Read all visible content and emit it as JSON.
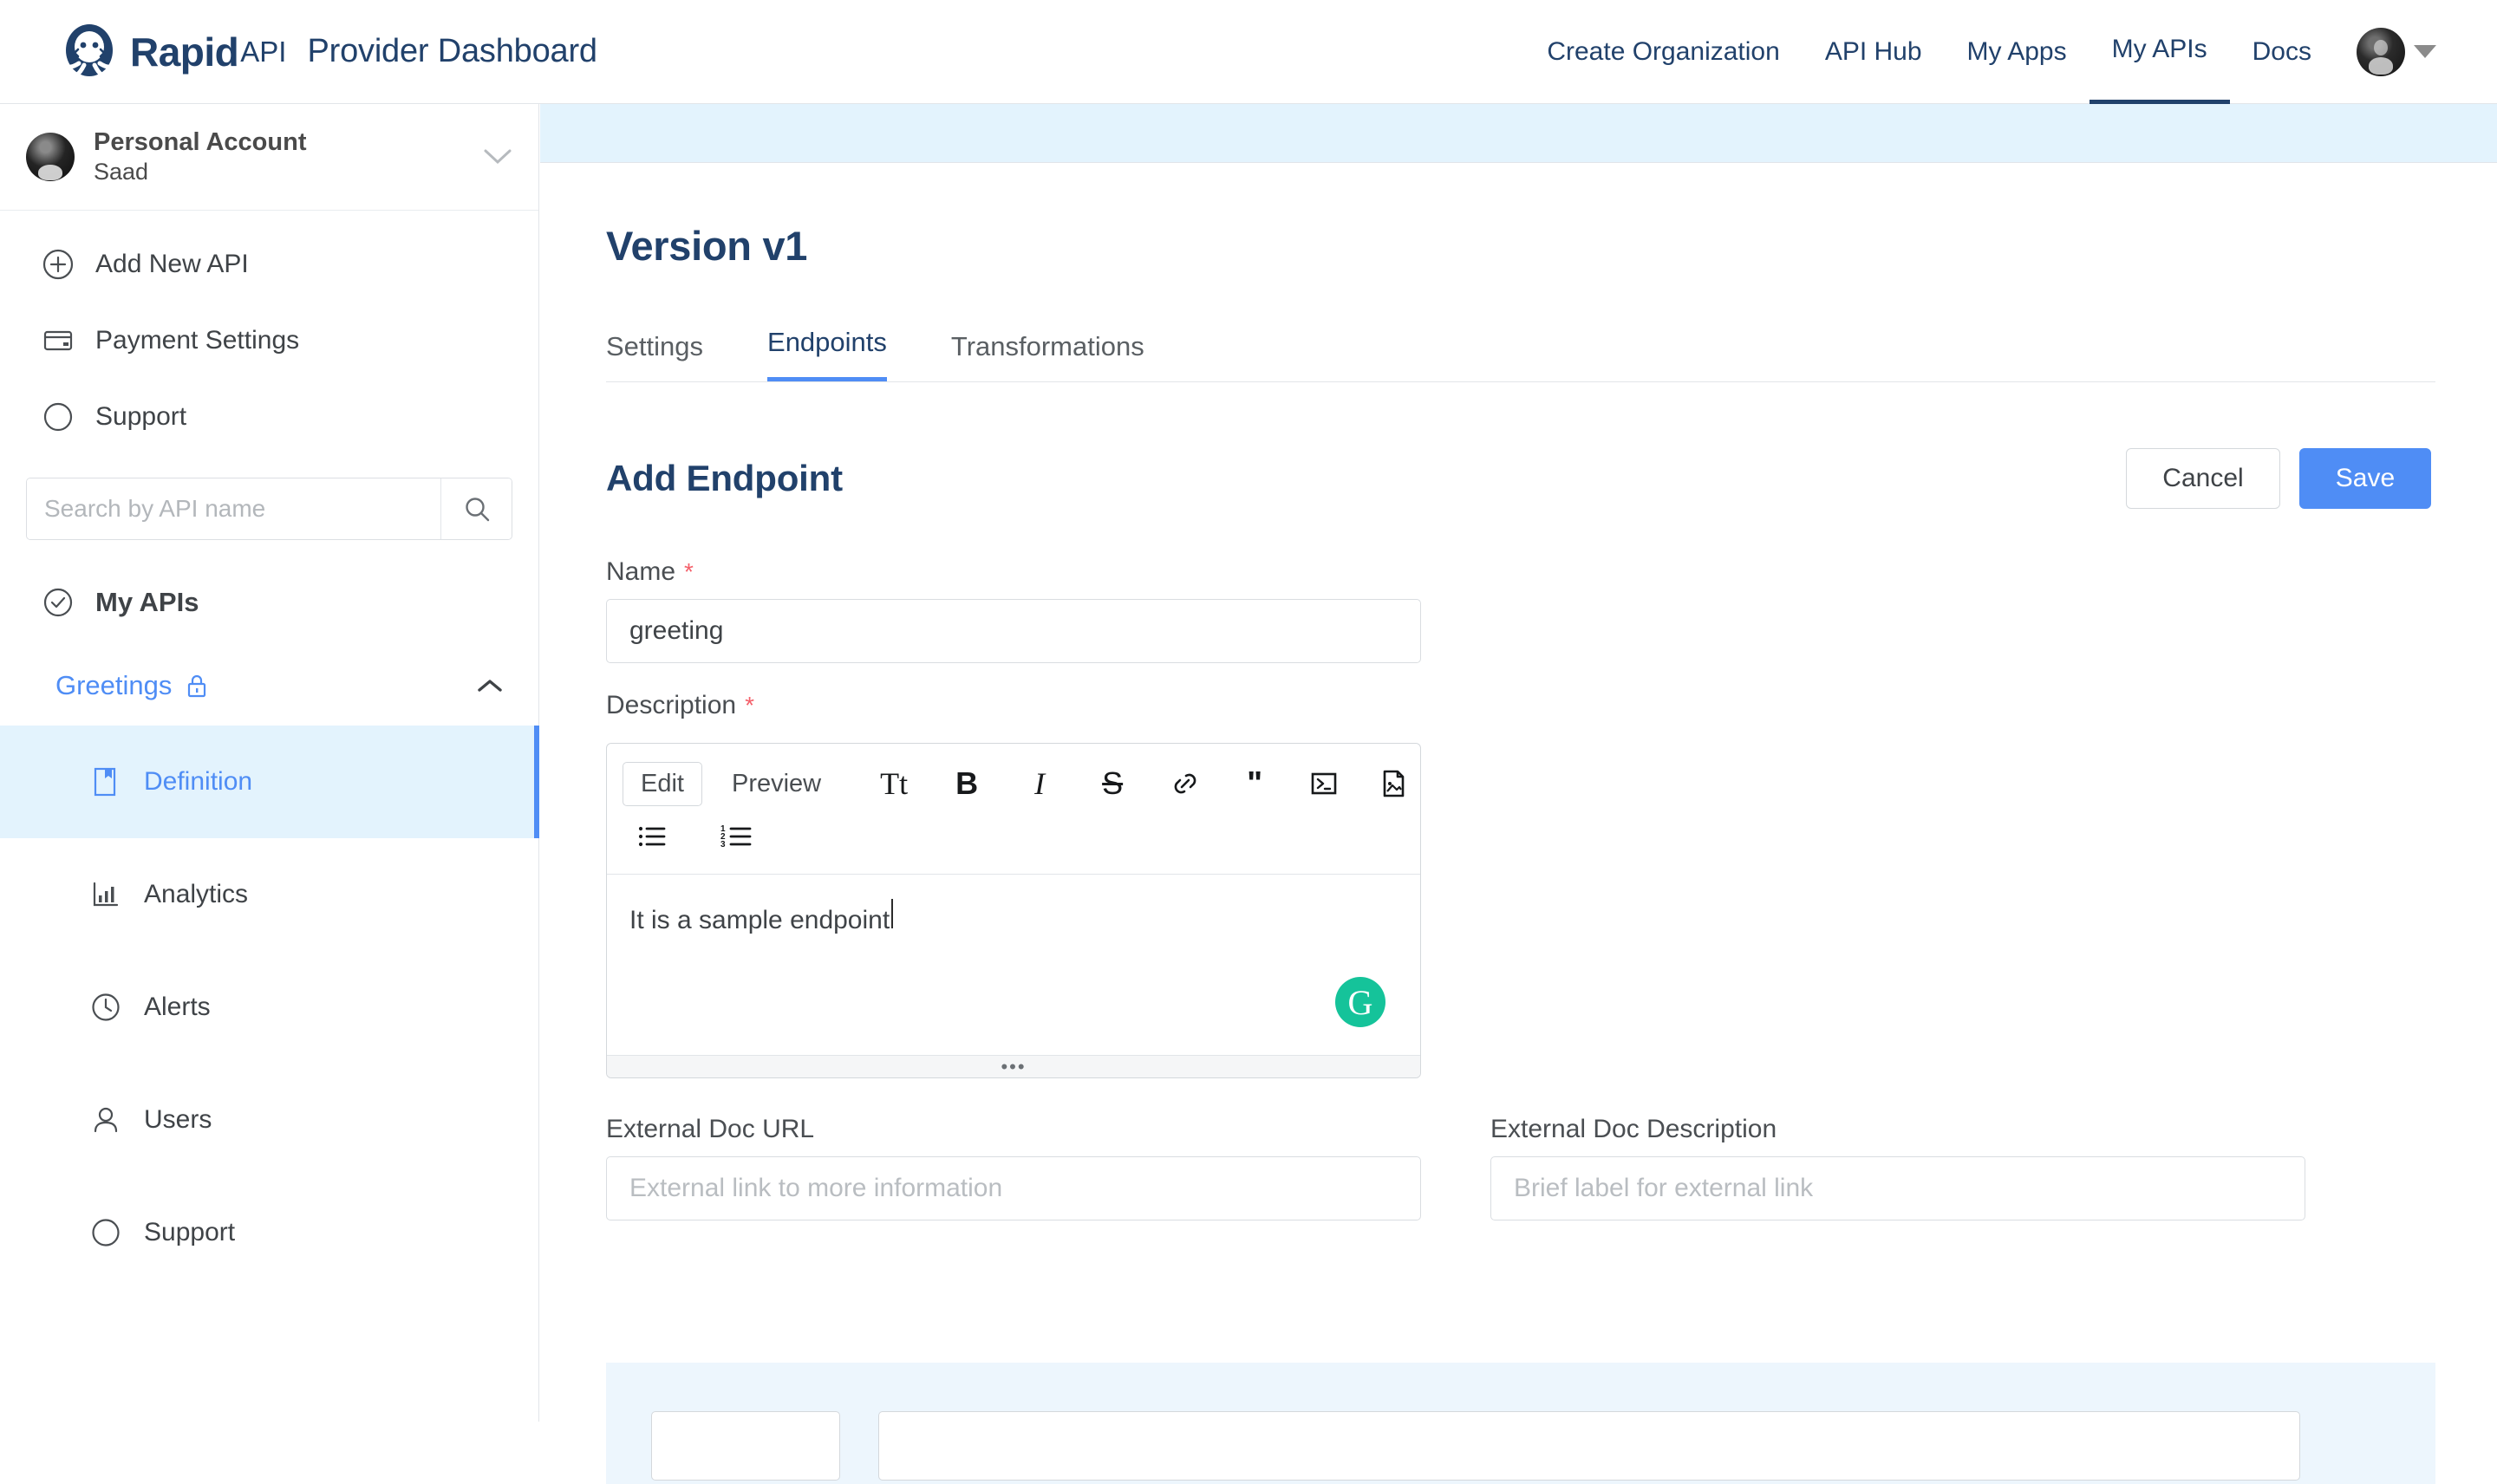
{
  "brand": {
    "name_bold": "Rapid",
    "name_light": "API",
    "subtitle": "Provider Dashboard",
    "logo_icon": "rapidapi-octopus-logo-icon",
    "primary_navy": "#21416b",
    "accent_blue": "#4f8df5",
    "required_red": "#f4606a",
    "panel_blue": "#e3f3fd"
  },
  "topnav": {
    "items": [
      {
        "label": "Create Organization",
        "active": false
      },
      {
        "label": "API Hub",
        "active": false
      },
      {
        "label": "My Apps",
        "active": false
      },
      {
        "label": "My APIs",
        "active": true
      },
      {
        "label": "Docs",
        "active": false
      }
    ],
    "avatar_icon": "user-avatar",
    "caret_icon": "caret-down-icon"
  },
  "sidebar": {
    "account": {
      "title": "Personal Account",
      "username": "Saad",
      "avatar_icon": "user-avatar",
      "chevron_icon": "chevron-down-icon"
    },
    "nav": [
      {
        "label": "Add New API",
        "icon": "plus-circle-icon"
      },
      {
        "label": "Payment Settings",
        "icon": "credit-card-icon"
      },
      {
        "label": "Support",
        "icon": "compass-icon"
      }
    ],
    "search": {
      "placeholder": "Search by API name",
      "value": "",
      "icon": "search-icon"
    },
    "my_apis": {
      "label": "My APIs",
      "icon": "check-circle-icon"
    },
    "api_group": {
      "label": "Greetings",
      "lock_icon": "lock-icon",
      "chevron_icon": "chevron-up-icon",
      "expanded": true
    },
    "sub_items": [
      {
        "label": "Definition",
        "icon": "book-icon",
        "active": true
      },
      {
        "label": "Analytics",
        "icon": "bar-chart-icon",
        "active": false
      },
      {
        "label": "Alerts",
        "icon": "clock-icon",
        "active": false
      },
      {
        "label": "Users",
        "icon": "user-icon",
        "active": false
      },
      {
        "label": "Support",
        "icon": "compass-icon",
        "active": false
      }
    ]
  },
  "main": {
    "version_title": "Version v1",
    "tabs": [
      {
        "label": "Settings",
        "active": false
      },
      {
        "label": "Endpoints",
        "active": true
      },
      {
        "label": "Transformations",
        "active": false
      }
    ],
    "section_title": "Add Endpoint",
    "cancel_label": "Cancel",
    "save_label": "Save",
    "form": {
      "name": {
        "label": "Name",
        "required_marker": "*",
        "value": "greeting",
        "placeholder": ""
      },
      "description": {
        "label": "Description",
        "required_marker": "*",
        "value": "It is a sample endpoint",
        "editor": {
          "edit_label": "Edit",
          "preview_label": "Preview",
          "tools_row1": [
            {
              "glyph": "Tt",
              "icon": "text-size-icon"
            },
            {
              "glyph": "B",
              "icon": "bold-icon"
            },
            {
              "glyph": "I",
              "icon": "italic-icon"
            },
            {
              "glyph": "S",
              "icon": "strikethrough-icon"
            },
            {
              "glyph": "",
              "icon": "link-icon"
            },
            {
              "glyph": "\"",
              "icon": "quote-icon"
            },
            {
              "glyph": "",
              "icon": "code-block-icon"
            },
            {
              "glyph": "",
              "icon": "image-icon"
            }
          ],
          "tools_row2": [
            {
              "icon": "bulleted-list-icon"
            },
            {
              "icon": "numbered-list-icon"
            }
          ],
          "grammarly_badge": "G",
          "resize_handle": "•••"
        }
      },
      "external_doc_url": {
        "label": "External Doc URL",
        "value": "",
        "placeholder": "External link to more information"
      },
      "external_doc_description": {
        "label": "External Doc Description",
        "value": "",
        "placeholder": "Brief label for external link"
      }
    }
  }
}
